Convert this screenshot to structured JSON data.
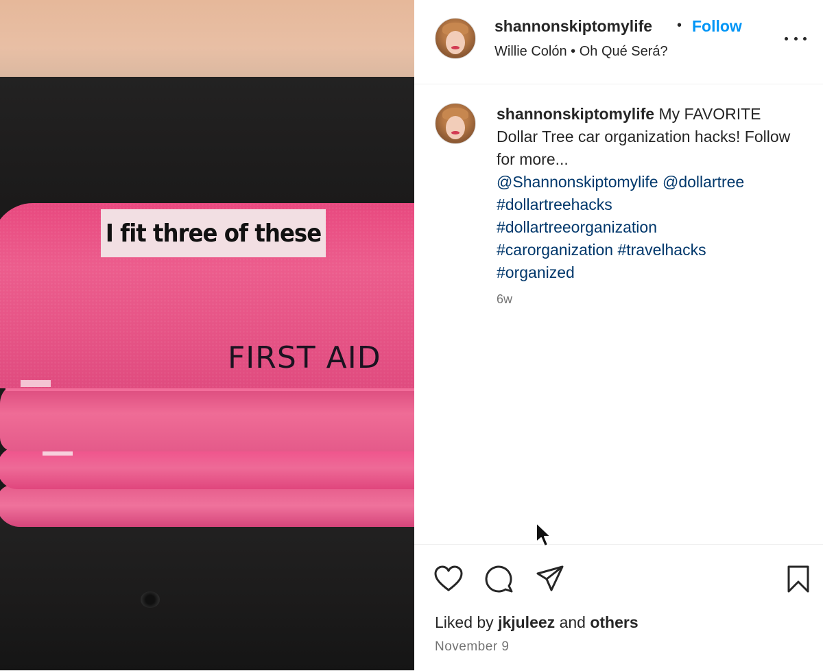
{
  "media": {
    "overlay_caption": "I fit three of these",
    "bag_label": "FIRST AID"
  },
  "header": {
    "username": "shannonskiptomylife",
    "separator": "•",
    "follow_label": "Follow",
    "audio": "Willie Colón  •  Oh Qué Será?",
    "more_icon": "more-horizontal-icon"
  },
  "caption": {
    "username": "shannonskiptomylife",
    "text": "My FAVORITE Dollar Tree car organization hacks! Follow for more...",
    "tags": [
      "@Shannonskiptomylife",
      "@dollartree",
      "#dollartreehacks",
      "#dollartreeorganization",
      "#carorganization",
      "#travelhacks",
      "#organized"
    ],
    "age": "6w"
  },
  "actions": {
    "like_icon": "heart-icon",
    "comment_icon": "comment-icon",
    "share_icon": "share-icon",
    "save_icon": "bookmark-icon"
  },
  "likes": {
    "prefix": "Liked by",
    "user": "jkjuleez",
    "middle": "and",
    "suffix": "others"
  },
  "post_date": "November 9",
  "colors": {
    "link_blue": "#0095f6",
    "hashtag_blue": "#00376b",
    "muted_gray": "#737373"
  }
}
